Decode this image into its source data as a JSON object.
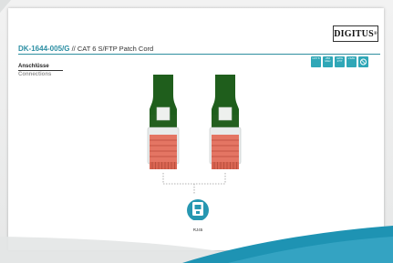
{
  "brand": {
    "name": "DIGITUS",
    "mark": "®"
  },
  "header": {
    "code": "DK-1644-005/G",
    "separator": " // ",
    "description": "CAT 6 S/FTP Patch Cord"
  },
  "section": {
    "title_de": "Anschlüsse",
    "title_en": "Connections"
  },
  "badges": [
    {
      "icon": "cat6-badge-icon",
      "text": "CAT 6"
    },
    {
      "icon": "250mhz-badge-icon",
      "text": "250 MHz"
    },
    {
      "icon": "awg-badge-icon",
      "text": "AWG 27/7"
    },
    {
      "icon": "lszh-badge-icon",
      "text": "LSZH"
    },
    {
      "icon": "halogen-free-badge-icon",
      "text": ""
    }
  ],
  "connector": {
    "label": "RJ45",
    "icon": "rj45-icon"
  },
  "colors": {
    "accent": "#2b8ea3",
    "badge": "#2fa7b7",
    "cable": "#1f5e1c",
    "plug_boot": "#e46a55",
    "swoosh": "#1e93b3"
  }
}
